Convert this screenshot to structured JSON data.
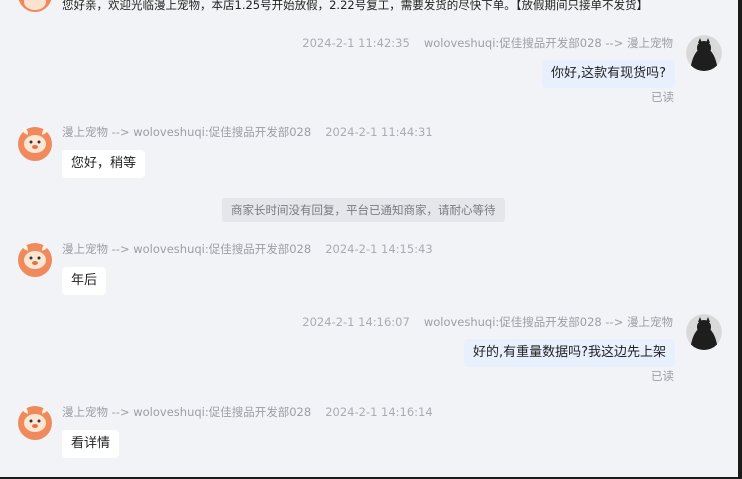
{
  "top_message": {
    "text": "您好亲，欢迎光临漫上宠物，本店1.25号开始放假，2.22号复工，需要发货的尽快下单。【放假期间只接单不发货】"
  },
  "messages": [
    {
      "sender": "woloveshuqi:促佳搜品开发部028 --> 漫上宠物",
      "time": "2024-2-1 11:42:35",
      "text": "你好,这款有现货吗?",
      "status": "已读"
    },
    {
      "sender": "漫上宠物 --> woloveshuqi:促佳搜品开发部028",
      "time": "2024-2-1 11:44:31",
      "text": "您好，稍等"
    },
    {
      "sender": "漫上宠物 --> woloveshuqi:促佳搜品开发部028",
      "time": "2024-2-1 14:15:43",
      "text": "年后"
    },
    {
      "sender": "woloveshuqi:促佳搜品开发部028 --> 漫上宠物",
      "time": "2024-2-1 14:16:07",
      "text": "好的,有重量数据吗?我这边先上架",
      "status": "已读"
    },
    {
      "sender": "漫上宠物 --> woloveshuqi:促佳搜品开发部028",
      "time": "2024-2-1 14:16:14",
      "text": "看详情"
    }
  ],
  "system_notice": "商家长时间没有回复，平台已通知商家，请耐心等待",
  "colors": {
    "background": "#f2f3f6",
    "mine_bubble": "#e8f0fe",
    "their_bubble": "#ffffff",
    "avatar_shop": "#f08a5d"
  },
  "icons": {
    "shop_avatar": "cartoon-dog-avatar-icon",
    "user_avatar": "dark-cat-avatar-icon"
  }
}
